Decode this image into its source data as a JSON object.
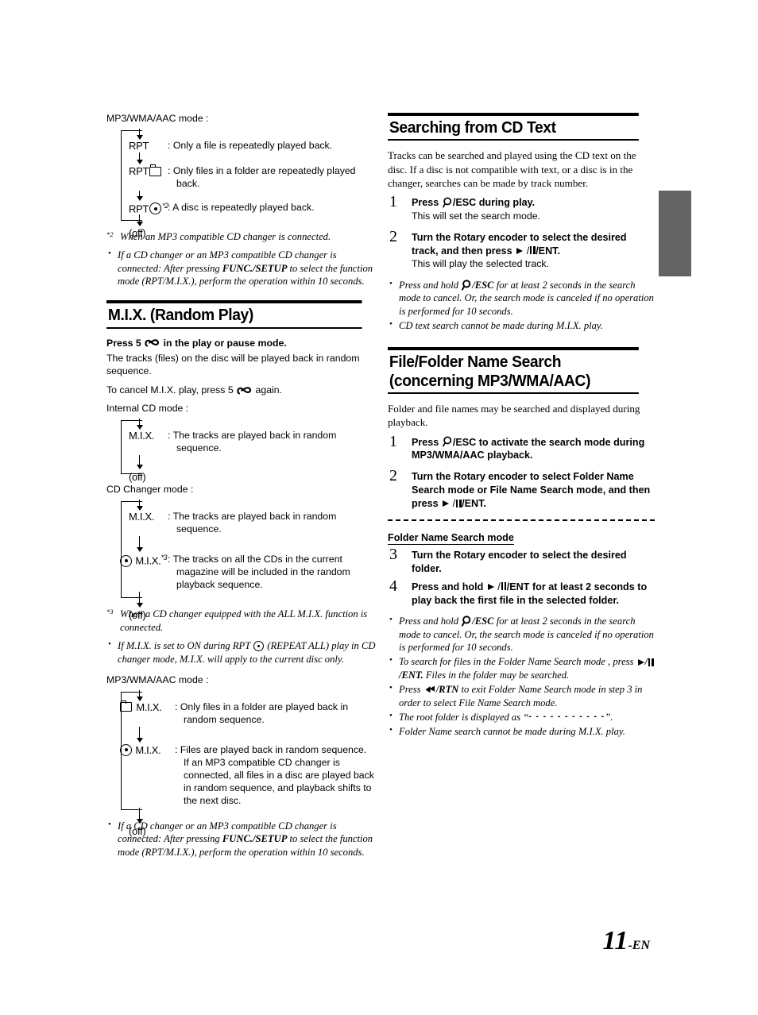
{
  "page": {
    "number": "11",
    "number_suffix": "-EN"
  },
  "left_column": {
    "mp3_rpt": {
      "mode_label": "MP3/WMA/AAC mode :",
      "items": [
        {
          "term": "RPT",
          "icon": "",
          "sup": "",
          "desc": "Only a file is repeatedly played back.",
          "desc_cont": ""
        },
        {
          "term": "RPT",
          "icon": "folder-icon",
          "sup": "",
          "desc": "Only files in a folder are repeatedly played",
          "desc_cont": "back."
        },
        {
          "term": "RPT",
          "icon": "disc-icon",
          "sup": "*2",
          "desc": "A disc is repeatedly played back.",
          "desc_cont": ""
        },
        {
          "term": "(off)",
          "icon": "",
          "sup": "",
          "desc": "",
          "desc_cont": ""
        }
      ],
      "footnote_mark": "*2",
      "footnote_text": "When an MP3 compatible CD changer is connected.",
      "note_1_part1": "If a CD changer or an MP3 compatible CD changer is connected: After pressing ",
      "note_1_bold": "FUNC./SETUP",
      "note_1_part2": " to select the function mode (RPT/M.I.X.), perform the operation within 10 seconds."
    },
    "mix_section": {
      "heading": "M.I.X. (Random Play)",
      "press_pre": "Press 5",
      "press_post": "in the play or pause mode.",
      "press_body": "The tracks (files) on the disc will be played back in random sequence.",
      "cancel_pre": "To cancel M.I.X. play, press 5",
      "cancel_post": "again.",
      "internal_label": "Internal CD mode :",
      "internal_items": [
        {
          "term": "M.I.X.",
          "icon": "",
          "sup": "",
          "desc": "The tracks are played back in random",
          "desc_cont": "sequence."
        },
        {
          "term": "(off)",
          "icon": "",
          "sup": "",
          "desc": "",
          "desc_cont": ""
        }
      ],
      "changer_label": "CD Changer mode :",
      "changer_items": [
        {
          "term": "M.I.X.",
          "icon": "",
          "sup": "",
          "desc": "The tracks are played back in random",
          "desc_cont": "sequence."
        },
        {
          "term": "M.I.X.",
          "icon": "disc-icon-before",
          "sup": "*3",
          "desc": "The tracks on all the CDs in the current",
          "desc_cont": "magazine will be included in the random playback sequence."
        },
        {
          "term": "(off)",
          "icon": "",
          "sup": "",
          "desc": "",
          "desc_cont": ""
        }
      ],
      "footnote_mark": "*3",
      "footnote_text": "When a CD changer equipped with the ALL M.I.X. function is connected.",
      "note_rpt_part1": "If M.I.X. is set to ON during RPT ",
      "note_rpt_part2": " (REPEAT ALL) play in CD changer mode, M.I.X. will apply to the current disc only.",
      "mp3_label": "MP3/WMA/AAC mode :",
      "mp3_items": [
        {
          "term": "M.I.X.",
          "icon": "folder-icon-before",
          "sup": "",
          "desc": "Only files in a folder are played back in",
          "desc_cont": "random sequence."
        },
        {
          "term": "M.I.X.",
          "icon": "disc-icon-before",
          "sup": "",
          "desc": "Files are played back in random sequence.",
          "desc_cont": "If an MP3 compatible CD changer is connected, all files in a disc are played back in random sequence, and playback shifts to the next disc."
        },
        {
          "term": "(off)",
          "icon": "",
          "sup": "",
          "desc": "",
          "desc_cont": ""
        }
      ],
      "note_final_part1": "If a CD changer or an MP3 compatible CD changer is connected: After pressing ",
      "note_final_bold": "FUNC./SETUP",
      "note_final_part2": " to select the function mode (RPT/M.I.X.), perform the operation within 10 seconds."
    }
  },
  "right_column": {
    "cd_text": {
      "heading": "Searching from CD Text",
      "intro": "Tracks can be searched and played using the CD text on the disc. If a disc is not compatible with text, or a disc is in the changer, searches can be made by track number.",
      "steps": [
        {
          "num": "1",
          "lead_pre": "Press",
          "lead_mid": "/ESC",
          "lead_post": "during play.",
          "sub": "This will set the search mode."
        },
        {
          "num": "2",
          "lead_pre": "Turn the",
          "lead_bold": "Rotary encoder",
          "lead_mid": "to select the desired track, and then press",
          "lead_post": "/ENT.",
          "sub": "This will play the selected track."
        }
      ],
      "note_1_pre": "Press and hold",
      "note_1_esc": "/ESC",
      "note_1_post": "for at least 2 seconds in the search mode to cancel. Or, the search mode is canceled if no operation is  performed for 10 seconds.",
      "note_2": "CD text search cannot be made during M.I.X. play."
    },
    "file_folder": {
      "heading_line1": "File/Folder Name Search",
      "heading_line2": "(concerning MP3/WMA/AAC)",
      "intro": "Folder and file names may be searched and displayed during playback.",
      "steps": [
        {
          "num": "1",
          "lead_pre": "Press",
          "lead_mid": "/ESC",
          "lead_post": "to activate the search mode during MP3/WMA/AAC playback."
        },
        {
          "num": "2",
          "lead_pre": "Turn the",
          "lead_bold": "Rotary encoder",
          "lead_mid": "to select Folder Name Search mode or File Name Search mode, and then press",
          "lead_post": "/ENT."
        }
      ],
      "subheading": "Folder Name Search mode",
      "steps2": [
        {
          "num": "3",
          "lead_pre": "Turn the",
          "lead_bold": "Rotary encoder",
          "lead_post": "to select the desired folder."
        },
        {
          "num": "4",
          "lead_pre": "Press and hold",
          "lead_mid": "/ENT",
          "lead_post": "for at least 2 seconds to play back the first file in the selected folder."
        }
      ],
      "notes": {
        "n1_pre": "Press and hold",
        "n1_esc": "/ESC",
        "n1_post": "for at least 2 seconds in the search mode to cancel. Or, the search mode is canceled if no operation is performed for 10 seconds.",
        "n2_pre": "To search for files in the Folder Name Search mode , press",
        "n2_ent": "/ENT.",
        "n2_post": "Files in the folder may be searched.",
        "n3_pre": "Press",
        "n3_rtn": "/RTN",
        "n3_post": "to exit Folder Name Search mode in step 3 in order to select File Name Search mode.",
        "n4_pre": "The root folder is displayed as “",
        "n4_dash": "- - - - - - - - - - -",
        "n4_post": "”.",
        "n5": "Folder Name search cannot be made during M.I.X. play."
      }
    }
  }
}
